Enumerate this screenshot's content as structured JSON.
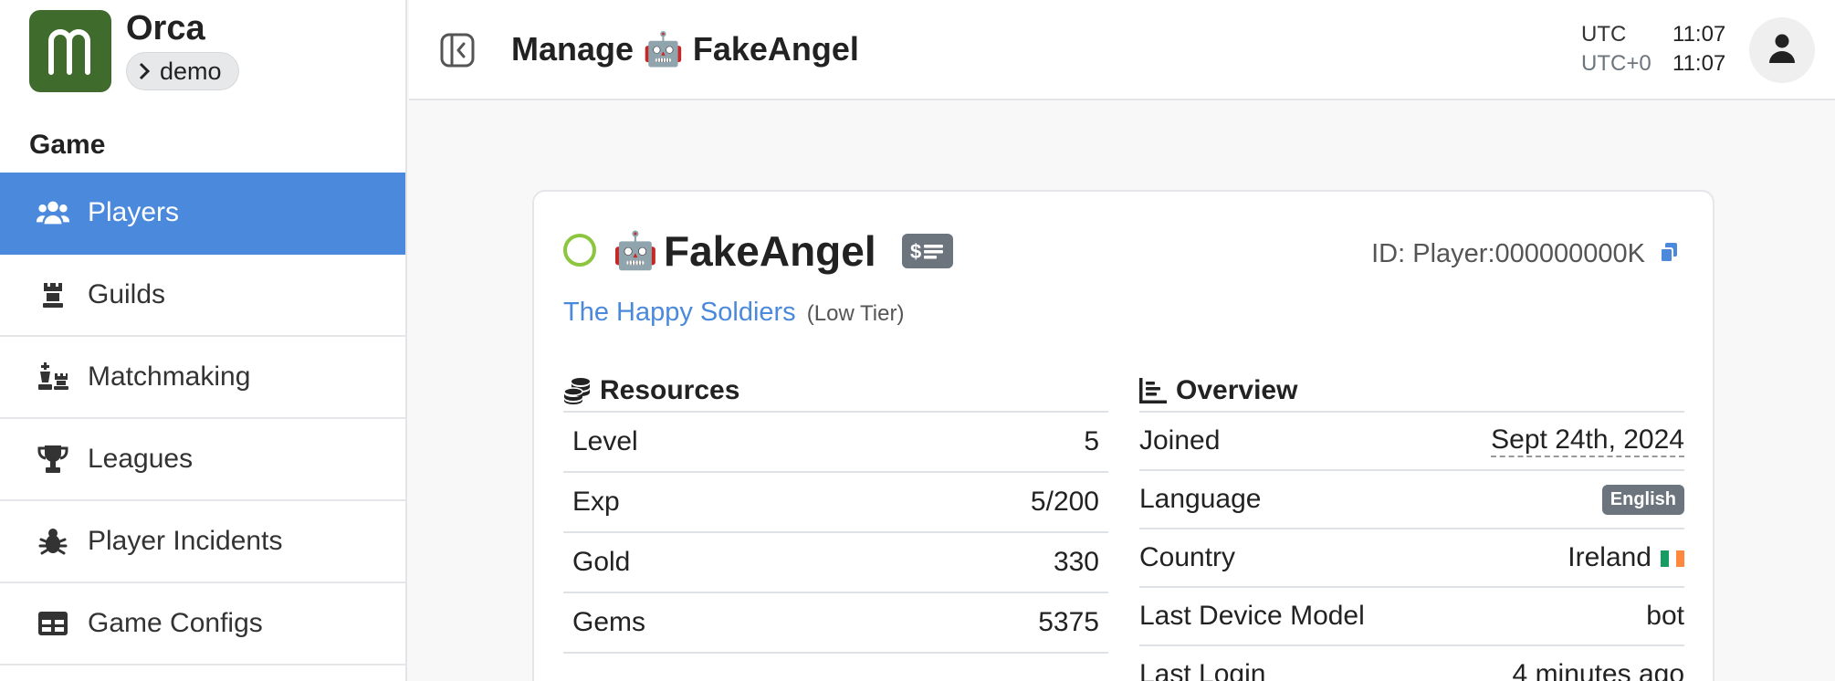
{
  "app": {
    "name": "Orca",
    "environment": "demo"
  },
  "sidebar": {
    "section_title": "Game",
    "items": [
      {
        "label": "Players",
        "icon": "users-icon",
        "active": true
      },
      {
        "label": "Guilds",
        "icon": "chess-rook-icon"
      },
      {
        "label": "Matchmaking",
        "icon": "chess-pieces-icon"
      },
      {
        "label": "Leagues",
        "icon": "trophy-icon"
      },
      {
        "label": "Player Incidents",
        "icon": "bug-icon"
      },
      {
        "label": "Game Configs",
        "icon": "table-icon"
      }
    ]
  },
  "header": {
    "title": "Manage 🤖 FakeAngel",
    "clock": [
      {
        "tz": "UTC",
        "time": "11:07"
      },
      {
        "tz": "UTC+0",
        "time": "11:07"
      }
    ]
  },
  "player": {
    "emoji": "🤖",
    "name": "FakeAngel",
    "status_color": "#8cc63f",
    "id_text": "ID: Player:000000000K",
    "guild_name": "The Happy Soldiers",
    "guild_tier": "(Low Tier)"
  },
  "resources": {
    "title": "Resources",
    "rows": [
      {
        "label": "Level",
        "value": "5"
      },
      {
        "label": "Exp",
        "value": "5/200"
      },
      {
        "label": "Gold",
        "value": "330"
      },
      {
        "label": "Gems",
        "value": "5375"
      }
    ]
  },
  "overview": {
    "title": "Overview",
    "joined_label": "Joined",
    "joined_value": "Sept 24th, 2024",
    "language_label": "Language",
    "language_value": "English",
    "country_label": "Country",
    "country_value": "Ireland",
    "device_label": "Last Device Model",
    "device_value": "bot",
    "login_label": "Last Login",
    "login_value": "4 minutes ago"
  },
  "colors": {
    "accent": "#4a89dc",
    "logo_bg": "#3f6b2d",
    "badge_bg": "#6c757d"
  }
}
